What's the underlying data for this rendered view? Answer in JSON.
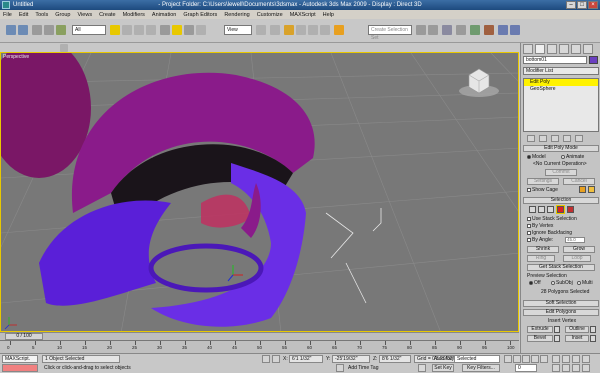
{
  "titlebar": {
    "document": "Untitled",
    "center": "- Project Folder: C:\\Users\\lewell\\Documents\\3dsmax  - Autodesk 3ds Max 2009  - Display : Direct 3D"
  },
  "menu": [
    "File",
    "Edit",
    "Tools",
    "Group",
    "Views",
    "Create",
    "Modifiers",
    "Animation",
    "Graph Editors",
    "Rendering",
    "Customize",
    "MAXScript",
    "Help"
  ],
  "toolbar": {
    "filter_value": "All",
    "refcoord_value": "View",
    "selection_set_placeholder": "Create Selection Set"
  },
  "viewport": {
    "label": "Perspective"
  },
  "command_panel": {
    "object_name": "bottom01",
    "modifier_list": "Modifier List",
    "stack": [
      "Edit Poly",
      "GeoSphere"
    ],
    "edit_poly_mode": {
      "title": "Edit Poly Mode",
      "model": "Model",
      "animate": "Animate",
      "no_op": "<No Current Operation>",
      "commit": "Commit",
      "settings": "Settings",
      "cancel": "Cancel",
      "show_cage": "Show Cage"
    },
    "selection": {
      "title": "Selection",
      "use_stack": "Use Stack Selection",
      "by_vertex": "By Vertex",
      "ignore_backfacing": "Ignore Backfacing",
      "by_angle": "By Angle:",
      "by_angle_value": "45.0",
      "shrink": "Shrink",
      "grow": "Grow",
      "ring": "Ring",
      "loop": "Loop",
      "get_stack": "Get Stack Selection",
      "preview_label": "Preview Selection",
      "preview_off": "Off",
      "preview_subobj": "SubObj",
      "preview_multi": "Multi",
      "status": "28 Polygons Selected"
    },
    "soft_selection": "Soft Selection",
    "edit_polygons": {
      "title": "Edit Polygons",
      "insert_vertex": "Insert Vertex",
      "extrude": "Extrude",
      "outline": "Outline",
      "bevel": "Bevel",
      "inset": "Inset"
    }
  },
  "timeline": {
    "slider": "0 / 100",
    "ticks": [
      "0",
      "5",
      "10",
      "15",
      "20",
      "25",
      "30",
      "35",
      "40",
      "45",
      "50",
      "55",
      "60",
      "65",
      "70",
      "75",
      "80",
      "85",
      "90",
      "95",
      "100"
    ]
  },
  "status": {
    "maxscript": "MAXScript.",
    "selected": "1 Object Selected",
    "prompt": "Click or click-and-drag to select objects",
    "x_label": "X:",
    "x_value": "6'1 1/32\"",
    "y_label": "Y:",
    "y_value": "-25'19/32\"",
    "z_label": "Z:",
    "z_value": "8'6 1/32\"",
    "grid": "Grid = 0'3 29/32\"",
    "add_time_tag": "Add Time Tag",
    "auto_key": "Auto Key",
    "auto_key_value": "Selected",
    "set_key": "Set Key",
    "key_filters": "Key Filters...",
    "frame": "0"
  }
}
